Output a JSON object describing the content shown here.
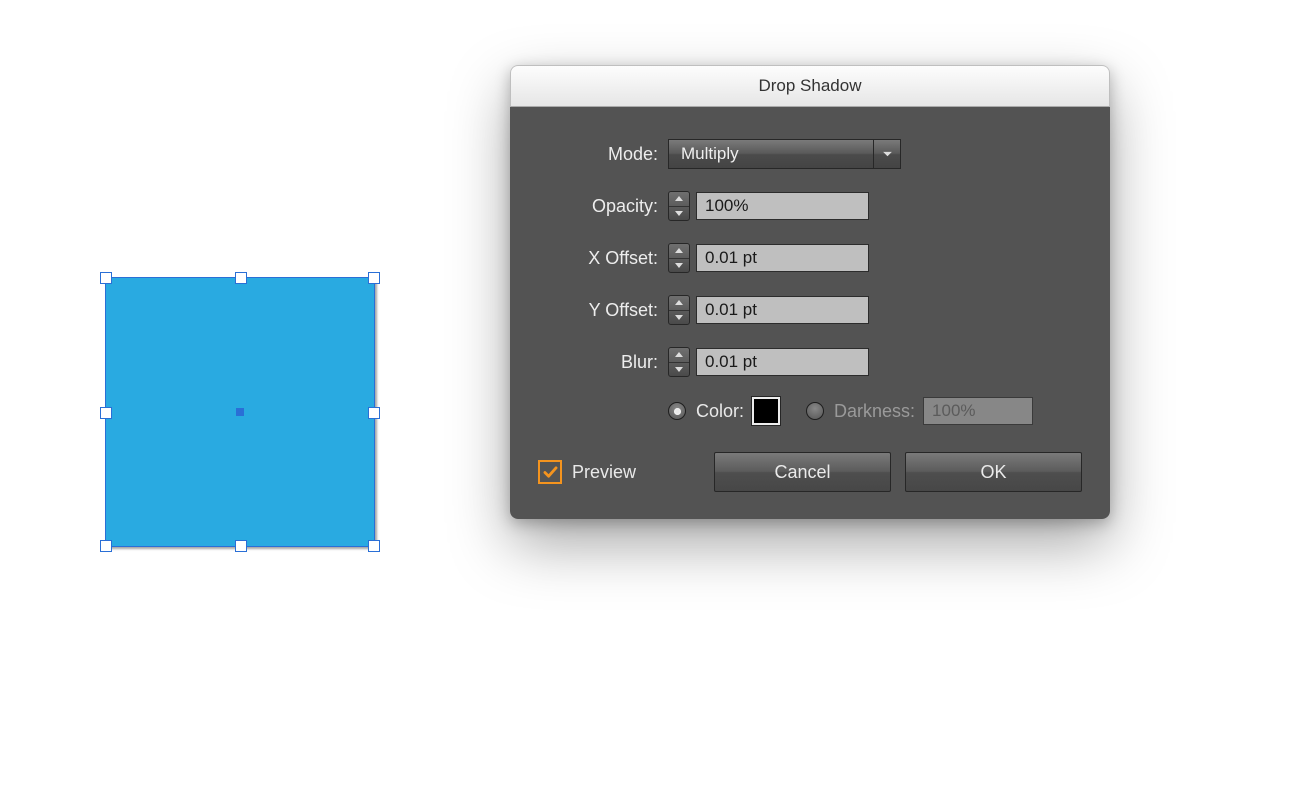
{
  "dialog": {
    "title": "Drop Shadow",
    "labels": {
      "mode": "Mode:",
      "opacity": "Opacity:",
      "xoffset": "X Offset:",
      "yoffset": "Y Offset:",
      "blur": "Blur:",
      "color": "Color:",
      "darkness": "Darkness:",
      "preview": "Preview"
    },
    "mode_value": "Multiply",
    "opacity_value": "100%",
    "xoffset_value": "0.01 pt",
    "yoffset_value": "0.01 pt",
    "blur_value": "0.01 pt",
    "color_swatch": "#000000",
    "color_selected": true,
    "darkness_value": "100%",
    "preview_checked": true,
    "buttons": {
      "cancel": "Cancel",
      "ok": "OK"
    }
  },
  "artwork": {
    "fill": "#29aae1",
    "selected": true
  }
}
